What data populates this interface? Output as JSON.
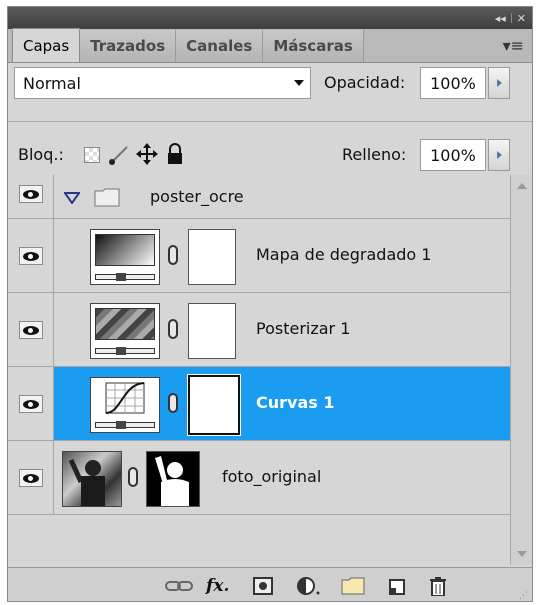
{
  "tabs": [
    {
      "label": "Capas",
      "active": true
    },
    {
      "label": "Trazados"
    },
    {
      "label": "Canales"
    },
    {
      "label": "Máscaras"
    }
  ],
  "blend": {
    "mode": "Normal",
    "opacity_label": "Opacidad:",
    "opacity_value": "100%"
  },
  "lock": {
    "label": "Bloq.:",
    "fill_label": "Relleno:",
    "fill_value": "100%"
  },
  "layers": [
    {
      "name": "poster_ocre",
      "type": "group",
      "expanded": true
    },
    {
      "name": "Mapa de degradado 1",
      "type": "adjustment"
    },
    {
      "name": "Posterizar 1",
      "type": "adjustment"
    },
    {
      "name": "Curvas 1",
      "type": "adjustment",
      "selected": true
    },
    {
      "name": "foto_original",
      "type": "image"
    }
  ],
  "colors": {
    "selection": "#1a9cf0",
    "panel_bg": "#d6d6d6",
    "titlebar": "#4a4a4a"
  },
  "icons": [
    "link-layers-icon",
    "fx-icon",
    "add-mask-icon",
    "adjustment-layer-icon",
    "new-group-icon",
    "new-layer-icon",
    "trash-icon"
  ]
}
